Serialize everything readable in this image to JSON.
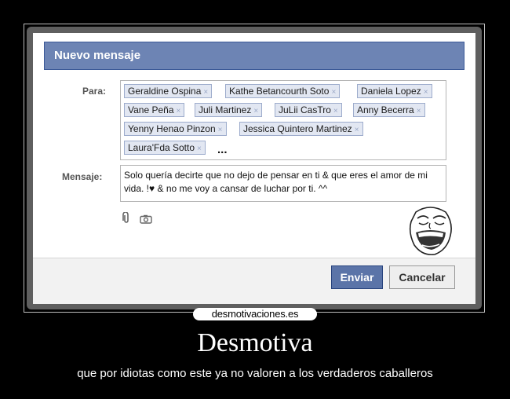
{
  "dialog": {
    "title": "Nuevo mensaje",
    "to_label": "Para:",
    "message_label": "Mensaje:",
    "recipients": [
      "Geraldine Ospina",
      "Kathe Betancourth Soto",
      "Daniela Lopez",
      "Vane Peña",
      "Juli Martinez",
      "JuLii CasTro",
      "Anny Becerra",
      "Yenny Henao Pinzon",
      "Jessica Quintero Martinez",
      "Laura'Fda Sotto"
    ],
    "remove_glyph": "×",
    "more_indicator": "...",
    "message_text": "Solo quería decirte que no dejo de pensar en ti & que eres el amor de mi vida. !♥ & no me voy a cansar de luchar por ti. ^^",
    "send_label": "Enviar",
    "cancel_label": "Cancelar",
    "icons": [
      "paperclip-icon",
      "camera-icon"
    ],
    "colors": {
      "header": "#6d84b4",
      "token_bg": "#e2e7f2",
      "send_button": "#5b74a8"
    }
  },
  "poster": {
    "watermark": "desmotivaciones.es",
    "title": "Desmotiva",
    "subtitle": "que por idiotas como este ya no valoren a los verdaderos caballeros"
  }
}
